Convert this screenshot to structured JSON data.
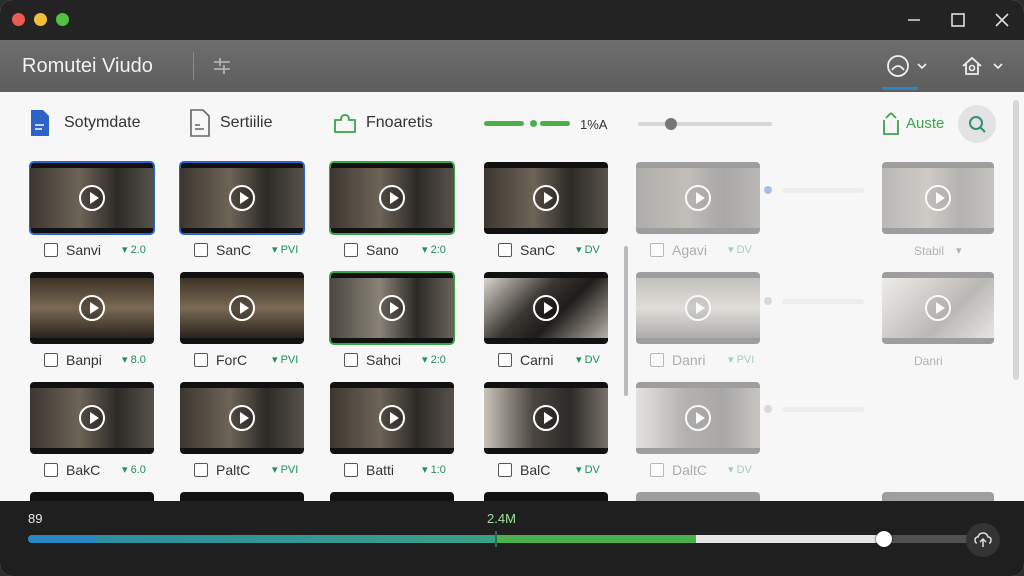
{
  "window": {
    "title": "Romutei Viudo"
  },
  "toolbar": {
    "items": [
      {
        "label": "Sotymdate",
        "icon": "document-icon",
        "color": "#2c63c8"
      },
      {
        "label": "Sertiilie",
        "icon": "file-icon",
        "color": "#666666"
      },
      {
        "label": "Fnoaretis",
        "icon": "puzzle-icon",
        "color": "#3aa44a"
      }
    ],
    "progress_label": "1%A",
    "slider_value": 0.25,
    "share_label": "Auste",
    "accent": "#3aa44a"
  },
  "grid": {
    "rows": [
      [
        {
          "name": "Sanvi",
          "meta": "▾ 2.0",
          "selected": "blue"
        },
        {
          "name": "SanC",
          "meta": "▾ PVI",
          "selected": "blue"
        },
        {
          "name": "Sano",
          "meta": "▾ 2:0",
          "selected": "green"
        },
        {
          "name": "SanC",
          "meta": "▾ DV",
          "selected": ""
        }
      ],
      [
        {
          "name": "Banpi",
          "meta": "▾ 8.0",
          "selected": ""
        },
        {
          "name": "ForC",
          "meta": "▾ PVI",
          "selected": ""
        },
        {
          "name": "Sahci",
          "meta": "▾ 2:0",
          "selected": "green"
        },
        {
          "name": "Carni",
          "meta": "▾ DV",
          "selected": ""
        }
      ],
      [
        {
          "name": "BakC",
          "meta": "▾ 6.0",
          "selected": ""
        },
        {
          "name": "PaltC",
          "meta": "▾ PVI",
          "selected": ""
        },
        {
          "name": "Batti",
          "meta": "▾ 1:0",
          "selected": ""
        },
        {
          "name": "BalC",
          "meta": "▾ DV",
          "selected": ""
        }
      ]
    ],
    "faded_rows": [
      {
        "name": "Agavi",
        "meta": "▾ DV",
        "right_name": "Stabil",
        "right_meta": "▾"
      },
      {
        "name": "Danri",
        "meta": "▾ PVI",
        "right_name": "Danri",
        "right_meta": ""
      },
      {
        "name": "DaltC",
        "meta": "▾ DV",
        "right_name": "",
        "right_meta": ""
      }
    ]
  },
  "status": {
    "left": "89",
    "center": "2.4M",
    "progress": 0.87
  }
}
